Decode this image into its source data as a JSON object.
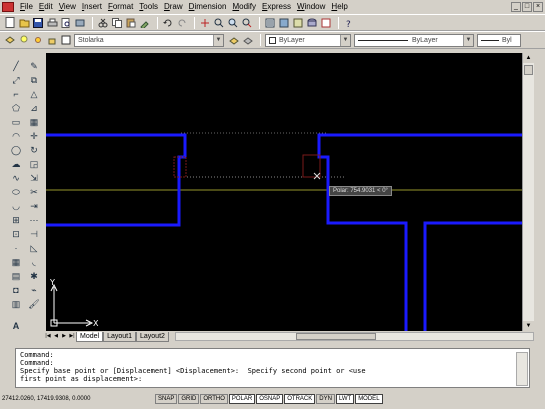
{
  "menu": {
    "items": [
      "File",
      "Edit",
      "View",
      "Insert",
      "Format",
      "Tools",
      "Draw",
      "Dimension",
      "Modify",
      "Express",
      "Window",
      "Help"
    ]
  },
  "window_buttons": [
    "_",
    "□",
    "×"
  ],
  "toolbar1": {
    "icons": [
      "new-icon",
      "open-icon",
      "save-icon",
      "print-icon",
      "preview-icon",
      "plot-icon",
      "cut-icon",
      "copy-icon",
      "paste-icon",
      "matchprop-icon",
      "undo-icon",
      "redo-icon",
      "pan-icon",
      "zoom-realtime-icon",
      "zoom-window-icon",
      "zoom-previous-icon",
      "properties-icon",
      "designcenter-icon",
      "toolpalettes-icon",
      "dbconnect-icon",
      "markup-icon",
      "help-icon"
    ]
  },
  "toolbar2": {
    "layer_value": "Stolarka",
    "color_value": "ByLayer",
    "linetype_value": "ByLayer",
    "lineweight_value": "Byl"
  },
  "tabs": [
    "Model",
    "Layout1",
    "Layout2"
  ],
  "polar_tooltip": "Polar: 754.9031 < 0°",
  "command_lines": [
    "Command:",
    "Command:",
    "Specify base point or [Displacement] <Displacement>:  Specify second point or <use",
    "first point as displacement>:"
  ],
  "coordinates": "27412.0260, 17419.9308, 0.0000",
  "status_buttons": [
    {
      "label": "SNAP",
      "on": false
    },
    {
      "label": "GRID",
      "on": false
    },
    {
      "label": "ORTHO",
      "on": false
    },
    {
      "label": "POLAR",
      "on": true
    },
    {
      "label": "OSNAP",
      "on": true
    },
    {
      "label": "OTRACK",
      "on": true
    },
    {
      "label": "DYN",
      "on": false
    },
    {
      "label": "LWT",
      "on": true
    },
    {
      "label": "MODEL",
      "on": true
    }
  ],
  "colors": {
    "wall": "#1a1aff",
    "background": "#000000",
    "tracking": "#c8c83c"
  },
  "ucs": {
    "x_label": "X",
    "y_label": "Y"
  }
}
